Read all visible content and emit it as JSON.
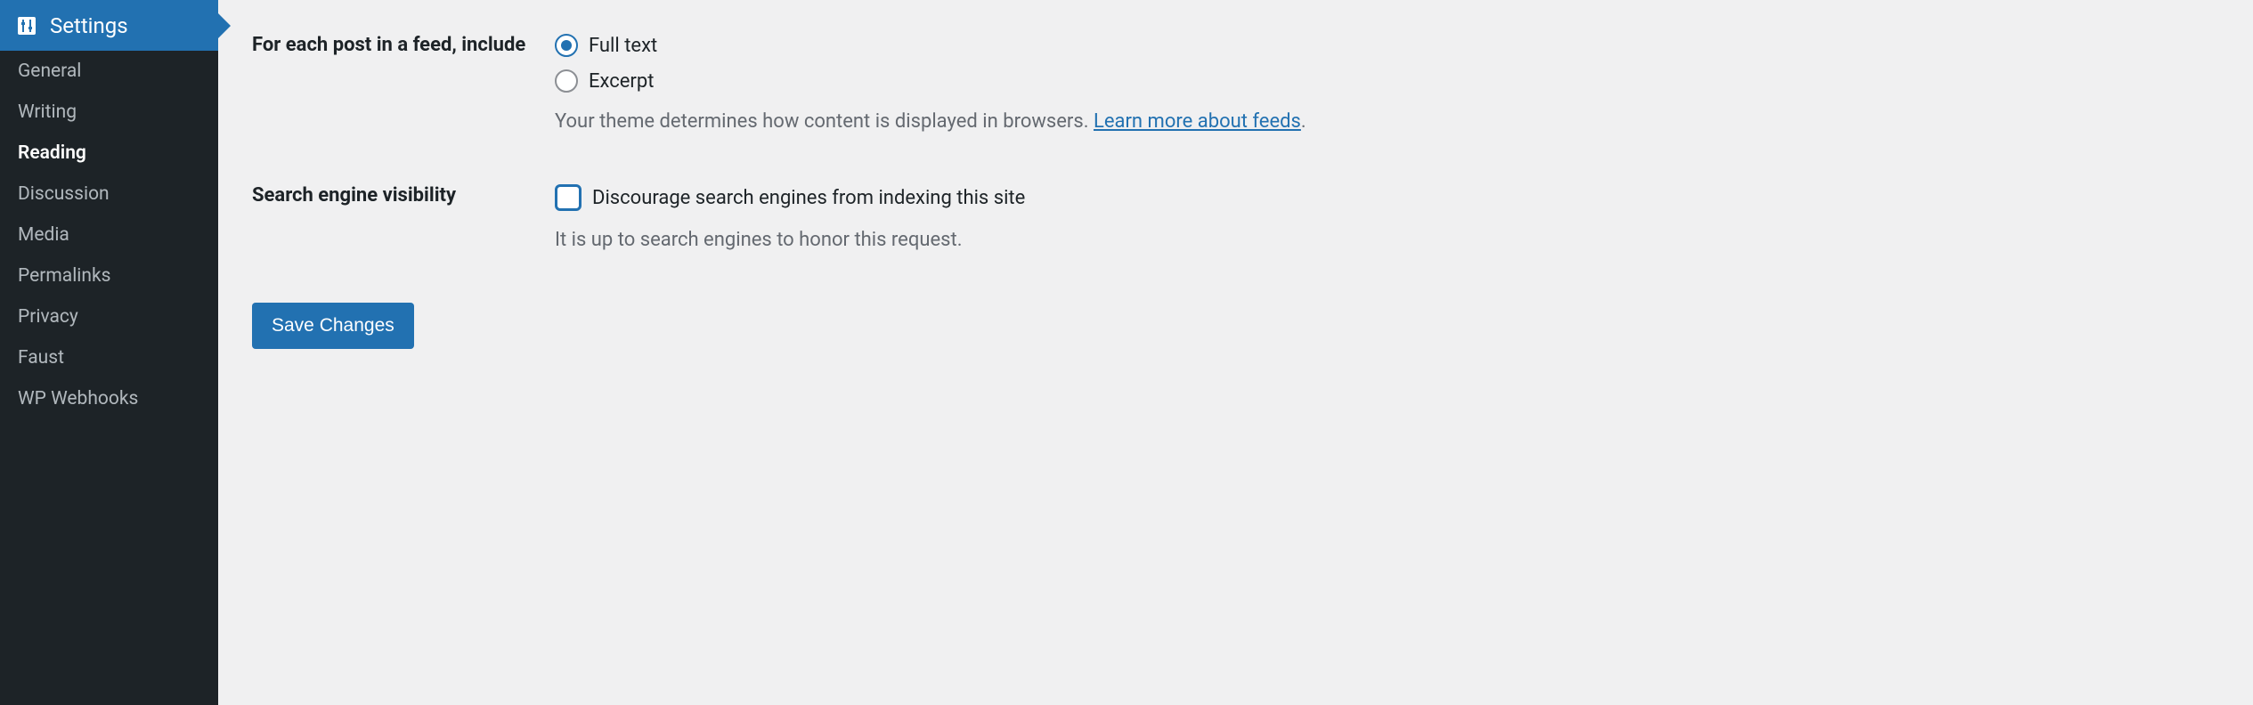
{
  "sidebar": {
    "header": "Settings",
    "items": [
      {
        "label": "General",
        "active": false
      },
      {
        "label": "Writing",
        "active": false
      },
      {
        "label": "Reading",
        "active": true
      },
      {
        "label": "Discussion",
        "active": false
      },
      {
        "label": "Media",
        "active": false
      },
      {
        "label": "Permalinks",
        "active": false
      },
      {
        "label": "Privacy",
        "active": false
      },
      {
        "label": "Faust",
        "active": false
      },
      {
        "label": "WP Webhooks",
        "active": false
      }
    ]
  },
  "form": {
    "feed": {
      "label": "For each post in a feed, include",
      "options": [
        {
          "label": "Full text",
          "checked": true
        },
        {
          "label": "Excerpt",
          "checked": false
        }
      ],
      "help_prefix": "Your theme determines how content is displayed in browsers. ",
      "help_link": "Learn more about feeds",
      "help_suffix": "."
    },
    "search": {
      "label": "Search engine visibility",
      "checkbox_label": "Discourage search engines from indexing this site",
      "checkbox_checked": false,
      "help": "It is up to search engines to honor this request."
    },
    "save_label": "Save Changes"
  }
}
